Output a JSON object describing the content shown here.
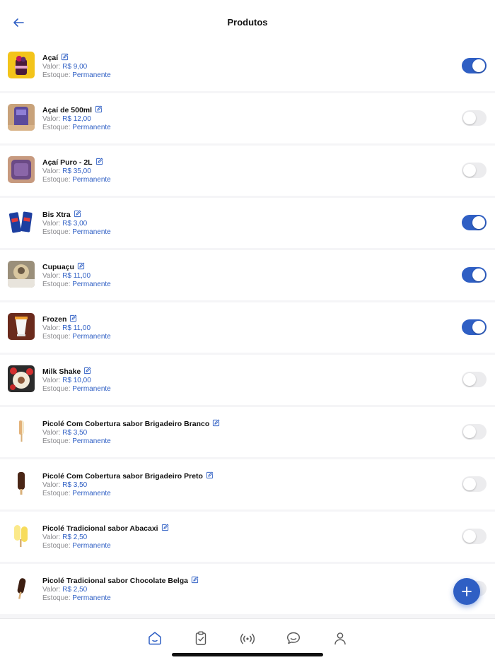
{
  "header": {
    "title": "Produtos",
    "back_icon": "arrow-left-icon"
  },
  "labels": {
    "price_prefix": "Valor:",
    "stock_prefix": "Estoque:"
  },
  "products": [
    {
      "name": "Açaí",
      "price": "R$ 9,00",
      "stock": "Permanente",
      "active": true
    },
    {
      "name": "Açaí de 500ml",
      "price": "R$ 12,00",
      "stock": "Permanente",
      "active": false
    },
    {
      "name": "Açaí Puro - 2L",
      "price": "R$ 35,00",
      "stock": "Permanente",
      "active": false
    },
    {
      "name": "Bis Xtra",
      "price": "R$ 3,00",
      "stock": "Permanente",
      "active": true
    },
    {
      "name": "Cupuaçu",
      "price": "R$ 11,00",
      "stock": "Permanente",
      "active": true
    },
    {
      "name": "Frozen",
      "price": "R$ 11,00",
      "stock": "Permanente",
      "active": true
    },
    {
      "name": "Milk Shake",
      "price": "R$ 10,00",
      "stock": "Permanente",
      "active": false
    },
    {
      "name": "Picolé Com Cobertura sabor Brigadeiro Branco",
      "price": "R$ 3,50",
      "stock": "Permanente",
      "active": false
    },
    {
      "name": "Picolé Com Cobertura sabor Brigadeiro Preto",
      "price": "R$ 3,50",
      "stock": "Permanente",
      "active": false
    },
    {
      "name": "Picolé Tradicional sabor Abacaxi",
      "price": "R$ 2,50",
      "stock": "Permanente",
      "active": false
    },
    {
      "name": "Picolé Tradicional sabor Chocolate Belga",
      "price": "R$ 2,50",
      "stock": "Permanente",
      "active": false
    }
  ],
  "fab": {
    "icon": "plus-icon"
  },
  "tabbar": {
    "active_index": 0,
    "tabs": [
      {
        "icon": "home-icon"
      },
      {
        "icon": "clipboard-check-icon"
      },
      {
        "icon": "broadcast-icon"
      },
      {
        "icon": "chat-icon"
      },
      {
        "icon": "user-icon"
      }
    ]
  },
  "colors": {
    "accent": "#2f5fc4",
    "toggle_off": "#ececee",
    "muted_text": "#8a8a8e"
  }
}
